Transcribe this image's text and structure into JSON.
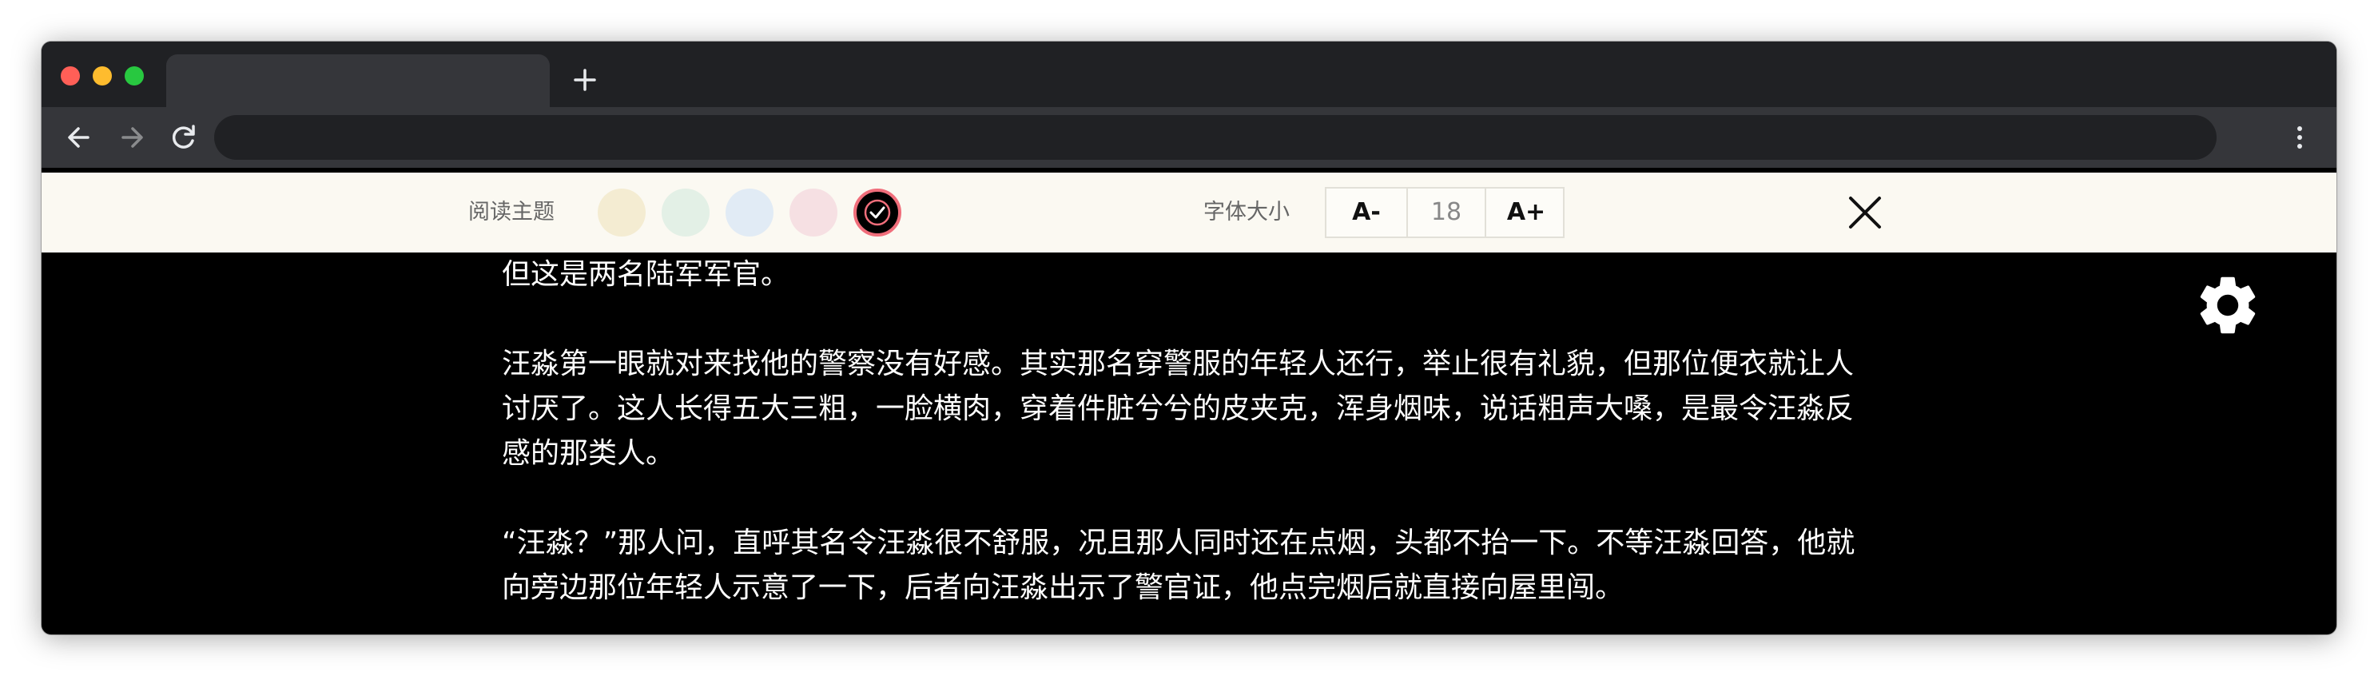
{
  "browser": {
    "tab_title": "",
    "new_tab_icon": "plus-icon",
    "address": ""
  },
  "reader_settings": {
    "theme_label": "阅读主题",
    "themes": [
      {
        "name": "beige",
        "color": "#f4ecd2"
      },
      {
        "name": "green",
        "color": "#e3f0e6"
      },
      {
        "name": "blue",
        "color": "#e1ebf5"
      },
      {
        "name": "pink",
        "color": "#f6e0e3"
      },
      {
        "name": "dark",
        "color": "#000000",
        "selected": true
      }
    ],
    "font_size_label": "字体大小",
    "decrease_label": "A-",
    "font_size_value": "18",
    "increase_label": "A+",
    "close_icon": "close-icon"
  },
  "content": {
    "paragraphs": [
      "但这是两名陆军军官。",
      "汪淼第一眼就对来找他的警察没有好感。其实那名穿警服的年轻人还行，举止很有礼貌，但那位便衣就让人讨厌了。这人长得五大三粗，一脸横肉，穿着件脏兮兮的皮夹克，浑身烟味，说话粗声大嗓，是最令汪淼反感的那类人。",
      "“汪淼？”那人问，直呼其名令汪淼很不舒服，况且那人同时还在点烟，头都不抬一下。不等汪淼回答，他就向旁边那位年轻人示意了一下，后者向汪淼出示了警官证，他点完烟后就直接向屋里闯。"
    ],
    "settings_icon": "gear-icon"
  }
}
